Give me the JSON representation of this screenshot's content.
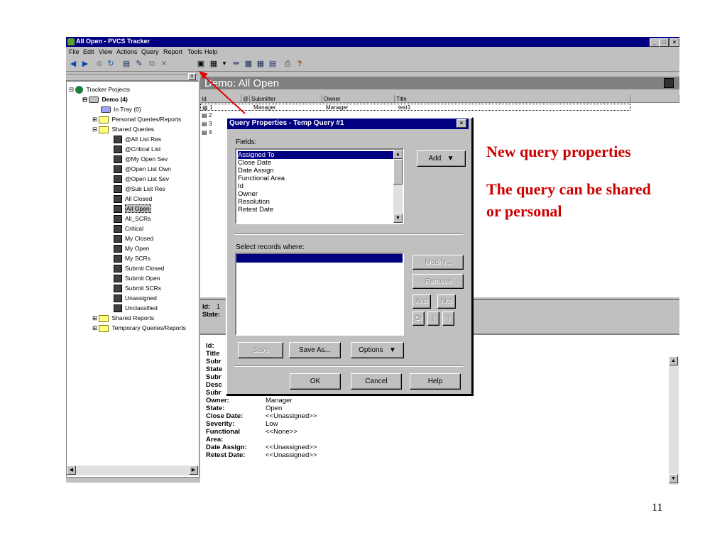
{
  "window": {
    "title": "All Open - PVCS Tracker",
    "min_label": "_",
    "max_label": "□",
    "close_label": "×"
  },
  "menu": [
    "File",
    "Edit",
    "View",
    "Actions",
    "Query",
    "Report",
    "Tools",
    "Help"
  ],
  "toolbar_icons": [
    "back-icon",
    "forward-icon",
    "stop-icon",
    "refresh-icon",
    "list-icon",
    "edit-icon",
    "copy-icon",
    "delete-icon",
    "query-icon",
    "properties-icon",
    "dropdown-icon",
    "report-icon",
    "view1-icon",
    "view2-icon",
    "view3-icon",
    "print-icon",
    "help-icon"
  ],
  "tree": {
    "root": "Tracker Projects",
    "project": "Demo (4)",
    "items": [
      "In Tray (0)",
      "Personal Queries/Reports",
      "Shared Queries",
      "@All List Res",
      "@Critical List",
      "@My Open Sev",
      "@Open List Own",
      "@Open List Sev",
      "@Sub List Res",
      "All Closed",
      "All Open",
      "All_SCRs",
      "Critical",
      "My Closed",
      "My Open",
      "My SCRs",
      "Submit Closed",
      "Submit Open",
      "Submit SCRs",
      "Unassigned",
      "Unclassified",
      "Shared Reports",
      "Temporary Queries/Reports"
    ]
  },
  "panel_title": "Demo: All Open",
  "grid": {
    "columns": [
      "Id",
      "@",
      "Submitter",
      "Owner",
      "Title"
    ],
    "rows": [
      {
        "id": "1",
        "submitter": "Manager",
        "owner": "Manager",
        "title": "test1"
      },
      {
        "id": "2"
      },
      {
        "id": "3"
      },
      {
        "id": "4"
      }
    ]
  },
  "summary": {
    "id_label": "Id:",
    "id_value": "1",
    "state_label": "State:"
  },
  "details_truncated": [
    "Id:",
    "Title",
    "Subr",
    "State",
    "Subr",
    "Desc",
    "Subr"
  ],
  "details": [
    {
      "label": "Owner:",
      "value": "Manager"
    },
    {
      "label": "State:",
      "value": "Open"
    },
    {
      "label": "Close Date:",
      "value": "<<Unassigned>>"
    },
    {
      "label": "Severity:",
      "value": "Low"
    },
    {
      "label": "Functional",
      "value": "<<None>>"
    },
    {
      "label": "Area:",
      "value": ""
    },
    {
      "label": "Date Assign:",
      "value": "<<Unassigned>>"
    },
    {
      "label": "Retest Date:",
      "value": "<<Unassigned>>"
    }
  ],
  "dialog": {
    "title": "Query Properties - Temp Query #1",
    "close_label": "×",
    "fields_label": "Fields:",
    "fields": [
      "Assigned To",
      "Close Date",
      "Date Assign",
      "Functional Area",
      "Id",
      "Owner",
      "Resolution",
      "Retest Date"
    ],
    "add_label": "Add",
    "select_label": "Select records where:",
    "modify_label": "Modify...",
    "remove_label": "Remove",
    "and_label": "And",
    "not_label": "Not",
    "or_label": "Or",
    "lparen_label": "(",
    "rparen_label": ")",
    "save_label": "Save",
    "saveas_label": "Save As...",
    "options_label": "Options",
    "ok_label": "OK",
    "cancel_label": "Cancel",
    "help_label": "Help"
  },
  "annotations": [
    "New query properties",
    "The query can be shared",
    "or personal"
  ],
  "page_number": "11",
  "colors": {
    "title_bar": "#000080",
    "annotation": "#cc0000",
    "face": "#c0c0c0"
  }
}
